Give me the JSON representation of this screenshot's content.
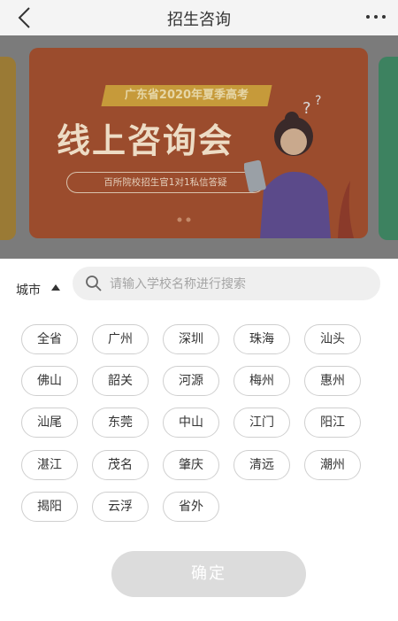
{
  "header": {
    "title": "招生咨询"
  },
  "banner": {
    "ribbon": "广东省2020年夏季高考",
    "headline": "线上咨询会",
    "subtitle": "百所院校招生官1对1私信答疑"
  },
  "filter": {
    "city_label": "城市",
    "search_placeholder": "请输入学校名称进行搜索",
    "search_value": ""
  },
  "cities": [
    "全省",
    "广州",
    "深圳",
    "珠海",
    "汕头",
    "佛山",
    "韶关",
    "河源",
    "梅州",
    "惠州",
    "汕尾",
    "东莞",
    "中山",
    "江门",
    "阳江",
    "湛江",
    "茂名",
    "肇庆",
    "清远",
    "潮州",
    "揭阳",
    "云浮",
    "省外"
  ],
  "confirm_label": "确定"
}
